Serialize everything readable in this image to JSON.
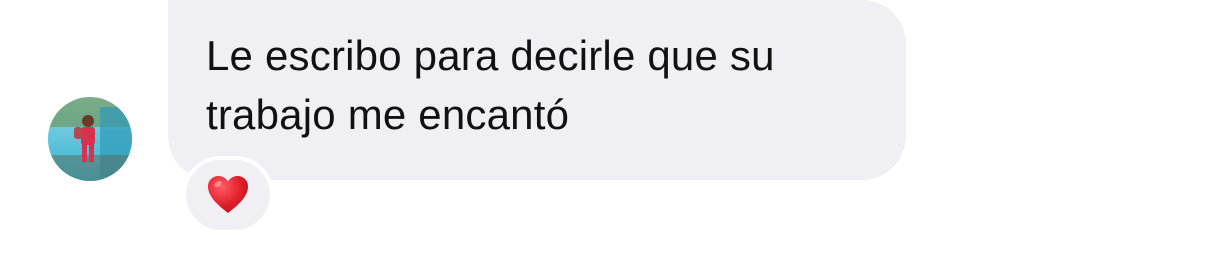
{
  "message": {
    "text": "Le escribo para decirle que su\ntrabajo me encantó",
    "reaction": {
      "icon": "heart-icon",
      "color": "#e0202c"
    }
  },
  "avatar": {
    "icon": "avatar"
  },
  "colors": {
    "bubble": "#efeff4",
    "text": "#111114",
    "background": "#ffffff"
  }
}
